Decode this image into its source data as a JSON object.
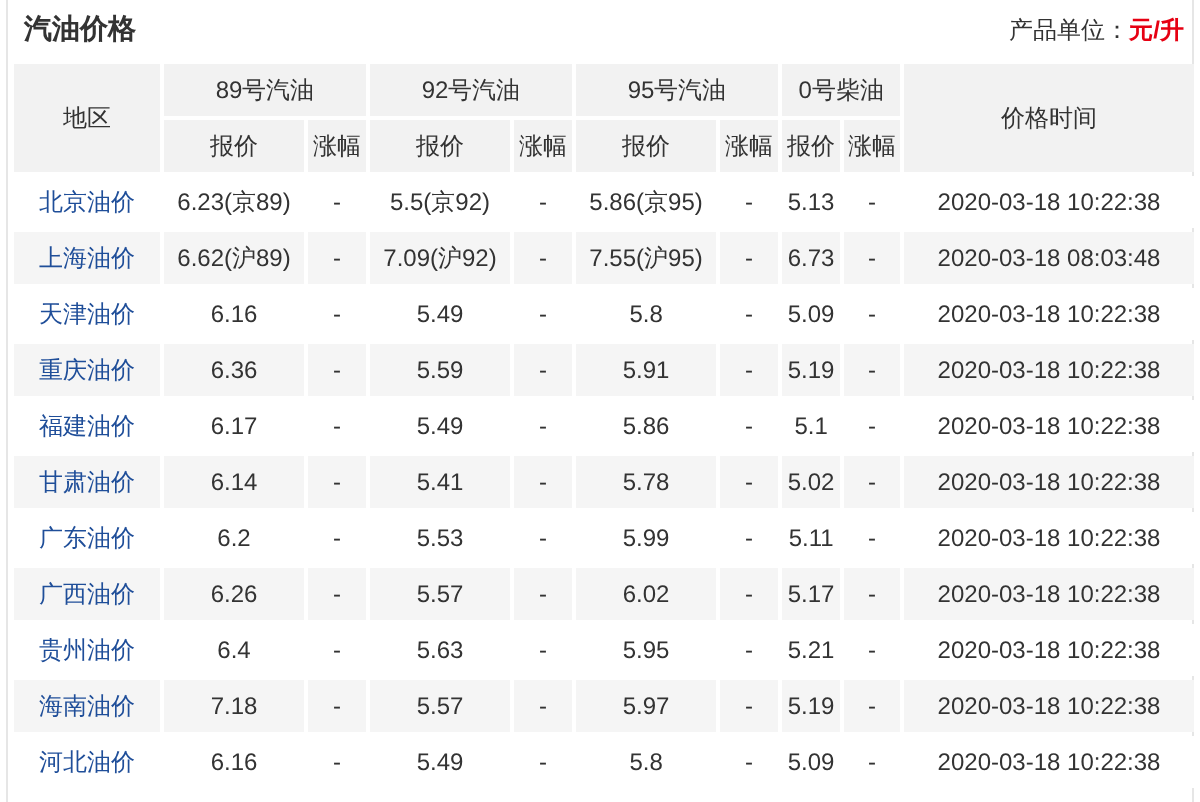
{
  "title": "汽油价格",
  "unit": {
    "label": "产品单位：",
    "value": "元/升"
  },
  "table": {
    "region_header": "地区",
    "time_header": "价格时间",
    "groups": [
      {
        "label": "89号汽油",
        "sub_headers": [
          "报价",
          "涨幅"
        ]
      },
      {
        "label": "92号汽油",
        "sub_headers": [
          "报价",
          "涨幅"
        ]
      },
      {
        "label": "95号汽油",
        "sub_headers": [
          "报价",
          "涨幅"
        ]
      },
      {
        "label": "0号柴油",
        "sub_headers": [
          "报价",
          "涨幅"
        ]
      }
    ],
    "rows": [
      {
        "region": "北京油价",
        "cells": [
          [
            "6.23(京89)",
            "-"
          ],
          [
            "5.5(京92)",
            "-"
          ],
          [
            "5.86(京95)",
            "-"
          ],
          [
            "5.13",
            "-"
          ]
        ],
        "time": "2020-03-18 10:22:38"
      },
      {
        "region": "上海油价",
        "cells": [
          [
            "6.62(沪89)",
            "-"
          ],
          [
            "7.09(沪92)",
            "-"
          ],
          [
            "7.55(沪95)",
            "-"
          ],
          [
            "6.73",
            "-"
          ]
        ],
        "time": "2020-03-18 08:03:48"
      },
      {
        "region": "天津油价",
        "cells": [
          [
            "6.16",
            "-"
          ],
          [
            "5.49",
            "-"
          ],
          [
            "5.8",
            "-"
          ],
          [
            "5.09",
            "-"
          ]
        ],
        "time": "2020-03-18 10:22:38"
      },
      {
        "region": "重庆油价",
        "cells": [
          [
            "6.36",
            "-"
          ],
          [
            "5.59",
            "-"
          ],
          [
            "5.91",
            "-"
          ],
          [
            "5.19",
            "-"
          ]
        ],
        "time": "2020-03-18 10:22:38"
      },
      {
        "region": "福建油价",
        "cells": [
          [
            "6.17",
            "-"
          ],
          [
            "5.49",
            "-"
          ],
          [
            "5.86",
            "-"
          ],
          [
            "5.1",
            "-"
          ]
        ],
        "time": "2020-03-18 10:22:38"
      },
      {
        "region": "甘肃油价",
        "cells": [
          [
            "6.14",
            "-"
          ],
          [
            "5.41",
            "-"
          ],
          [
            "5.78",
            "-"
          ],
          [
            "5.02",
            "-"
          ]
        ],
        "time": "2020-03-18 10:22:38"
      },
      {
        "region": "广东油价",
        "cells": [
          [
            "6.2",
            "-"
          ],
          [
            "5.53",
            "-"
          ],
          [
            "5.99",
            "-"
          ],
          [
            "5.11",
            "-"
          ]
        ],
        "time": "2020-03-18 10:22:38"
      },
      {
        "region": "广西油价",
        "cells": [
          [
            "6.26",
            "-"
          ],
          [
            "5.57",
            "-"
          ],
          [
            "6.02",
            "-"
          ],
          [
            "5.17",
            "-"
          ]
        ],
        "time": "2020-03-18 10:22:38"
      },
      {
        "region": "贵州油价",
        "cells": [
          [
            "6.4",
            "-"
          ],
          [
            "5.63",
            "-"
          ],
          [
            "5.95",
            "-"
          ],
          [
            "5.21",
            "-"
          ]
        ],
        "time": "2020-03-18 10:22:38"
      },
      {
        "region": "海南油价",
        "cells": [
          [
            "7.18",
            "-"
          ],
          [
            "5.57",
            "-"
          ],
          [
            "5.97",
            "-"
          ],
          [
            "5.19",
            "-"
          ]
        ],
        "time": "2020-03-18 10:22:38"
      },
      {
        "region": "河北油价",
        "cells": [
          [
            "6.16",
            "-"
          ],
          [
            "5.49",
            "-"
          ],
          [
            "5.8",
            "-"
          ],
          [
            "5.09",
            "-"
          ]
        ],
        "time": "2020-03-18 10:22:38"
      }
    ]
  }
}
